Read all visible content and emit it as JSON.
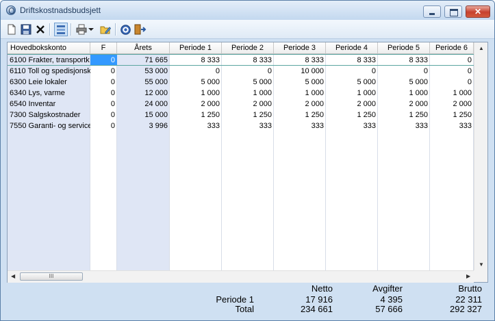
{
  "window": {
    "title": "Driftskostnadsbudsjett"
  },
  "toolbar": [
    "new-document",
    "save",
    "delete",
    "distribute",
    "print",
    "print-dropdown",
    "edit",
    "help",
    "exit"
  ],
  "table": {
    "columns": [
      "Hovedbokskonto",
      "F",
      "Årets",
      "Periode 1",
      "Periode 2",
      "Periode 3",
      "Periode 4",
      "Periode 5",
      "Periode 6"
    ],
    "rows": [
      [
        "6100 Frakter, transportk",
        "0",
        "71 665",
        "8 333",
        "8 333",
        "8 333",
        "8 333",
        "8 333",
        "0"
      ],
      [
        "6110 Toll og spedisjonsk",
        "0",
        "53 000",
        "0",
        "0",
        "10 000",
        "0",
        "0",
        "0"
      ],
      [
        "6300 Leie lokaler",
        "0",
        "55 000",
        "5 000",
        "5 000",
        "5 000",
        "5 000",
        "5 000",
        "0"
      ],
      [
        "6340 Lys, varme",
        "0",
        "12 000",
        "1 000",
        "1 000",
        "1 000",
        "1 000",
        "1 000",
        "1 000"
      ],
      [
        "6540 Inventar",
        "0",
        "24 000",
        "2 000",
        "2 000",
        "2 000",
        "2 000",
        "2 000",
        "2 000"
      ],
      [
        "7300 Salgskostnader",
        "0",
        "15 000",
        "1 250",
        "1 250",
        "1 250",
        "1 250",
        "1 250",
        "1 250"
      ],
      [
        "7550 Garanti- og service",
        "0",
        "3 996",
        "333",
        "333",
        "333",
        "333",
        "333",
        "333"
      ]
    ]
  },
  "scroll": {
    "thumb": "III"
  },
  "totals": {
    "headers": {
      "netto": "Netto",
      "avgifter": "Avgifter",
      "brutto": "Brutto"
    },
    "rows": [
      {
        "label": "Periode 1",
        "netto": "17 916",
        "avgifter": "4 395",
        "brutto": "22 311"
      },
      {
        "label": "Total",
        "netto": "234 661",
        "avgifter": "57 666",
        "brutto": "292 327"
      }
    ]
  },
  "colors": {
    "selected": "#3399ff",
    "readonly": "#dfe6f5",
    "accent": "#5aa5a0"
  }
}
